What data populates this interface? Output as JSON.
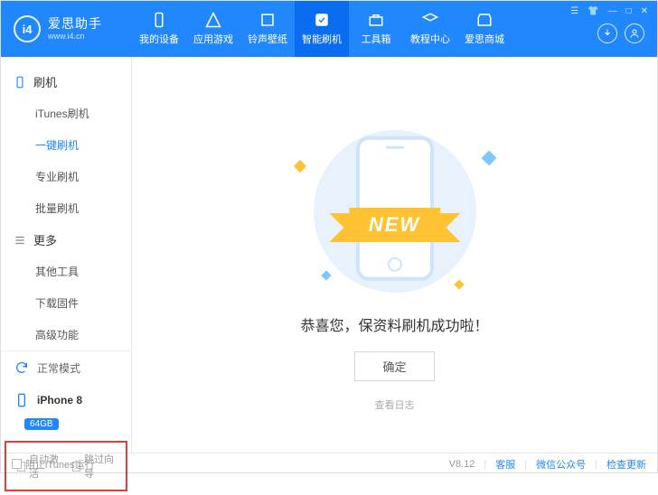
{
  "brand": {
    "title": "爱思助手",
    "url": "www.i4.cn",
    "logo_text": "i4"
  },
  "nav": [
    {
      "label": "我的设备"
    },
    {
      "label": "应用游戏"
    },
    {
      "label": "铃声壁纸"
    },
    {
      "label": "智能刷机"
    },
    {
      "label": "工具箱"
    },
    {
      "label": "教程中心"
    },
    {
      "label": "爱思商城"
    }
  ],
  "active_nav": 3,
  "sidebar": {
    "group1": {
      "title": "刷机",
      "items": [
        "iTunes刷机",
        "一键刷机",
        "专业刷机",
        "批量刷机"
      ],
      "active": 1
    },
    "group2": {
      "title": "更多",
      "items": [
        "其他工具",
        "下载固件",
        "高级功能"
      ]
    }
  },
  "status": {
    "mode": "正常模式",
    "device": "iPhone 8",
    "capacity": "64GB"
  },
  "checkboxes": {
    "auto_activate": "自动激活",
    "skip_guide": "跳过向导"
  },
  "main": {
    "ribbon": "NEW",
    "success": "恭喜您，保资料刷机成功啦！",
    "confirm": "确定",
    "view_log": "查看日志"
  },
  "footer": {
    "block_itunes": "阻止iTunes运行",
    "version": "V8.12",
    "support": "客服",
    "wechat": "微信公众号",
    "update": "检查更新"
  }
}
